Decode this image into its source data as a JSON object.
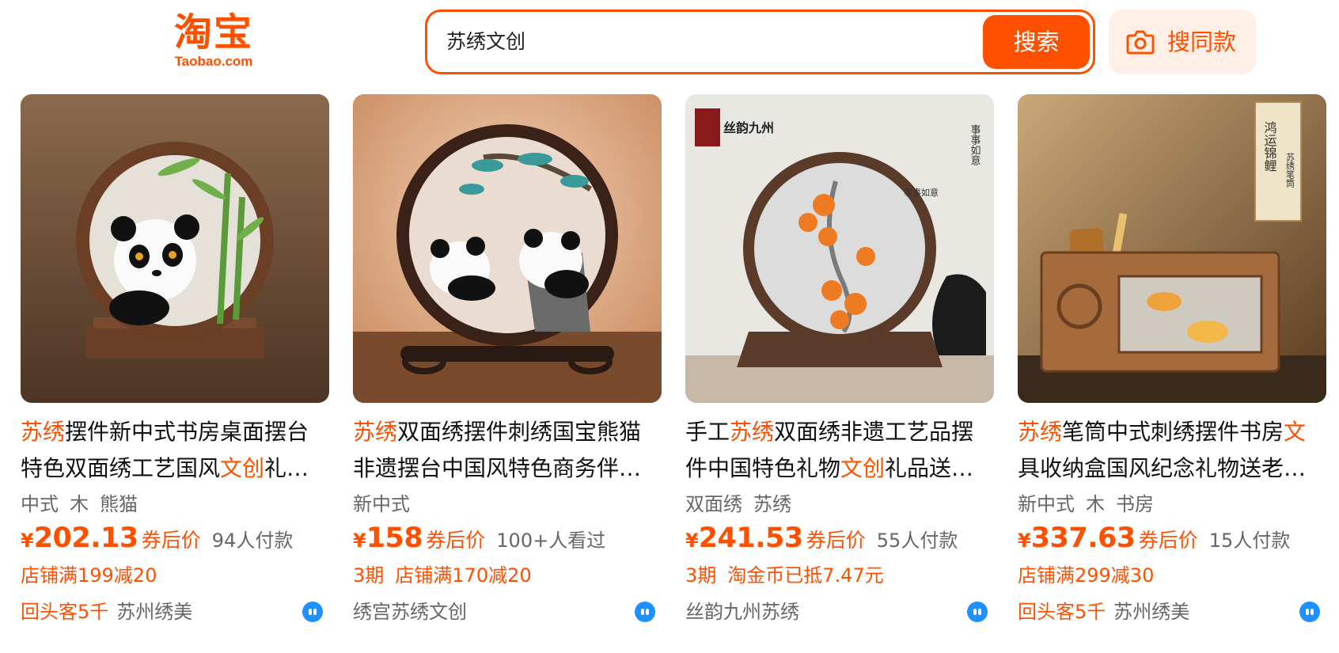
{
  "header": {
    "logo_mark": "淘宝",
    "logo_sub": "Taobao.com",
    "search_query": "苏绣文创",
    "search_button": "搜索",
    "same_button": "搜同款",
    "brand_color": "#ff5000"
  },
  "products": [
    {
      "title_parts": [
        [
          "苏绣",
          true
        ],
        [
          "摆件新中式书房桌面摆台特色双面绣工艺国风",
          false
        ],
        [
          "文创",
          true
        ],
        [
          "礼…",
          false
        ]
      ],
      "tags": [
        "中式",
        "木",
        "熊猫"
      ],
      "currency": "¥",
      "price": "202.13",
      "price_tag": "券后价",
      "sales": "94人付款",
      "promos": [
        "店铺满199减20"
      ],
      "repeat": "回头客5千",
      "shop": "苏州绣美"
    },
    {
      "title_parts": [
        [
          "苏绣",
          true
        ],
        [
          "双面绣摆件刺绣国宝熊猫非遗摆台中国风特色商务伴…",
          false
        ]
      ],
      "tags": [
        "新中式"
      ],
      "currency": "¥",
      "price": "158",
      "price_tag": "券后价",
      "sales": "100+人看过",
      "promos": [
        "3期",
        "店铺满170减20"
      ],
      "repeat": "",
      "shop": "绣宫苏绣文创"
    },
    {
      "title_parts": [
        [
          "手工",
          false
        ],
        [
          "苏绣",
          true
        ],
        [
          "双面绣非遗工艺品摆件中国特色礼物",
          false
        ],
        [
          "文创",
          true
        ],
        [
          "礼品送…",
          false
        ]
      ],
      "tags": [
        "双面绣",
        "苏绣"
      ],
      "currency": "¥",
      "price": "241.53",
      "price_tag": "券后价",
      "sales": "55人付款",
      "promos": [
        "3期",
        "淘金币已抵7.47元"
      ],
      "repeat": "",
      "shop": "丝韵九州苏绣"
    },
    {
      "title_parts": [
        [
          "苏绣",
          true
        ],
        [
          "笔筒中式刺绣摆件书房",
          false
        ],
        [
          "文",
          true
        ],
        [
          "具收纳盒国风纪念礼物送老…",
          false
        ]
      ],
      "tags": [
        "新中式",
        "木",
        "书房"
      ],
      "currency": "¥",
      "price": "337.63",
      "price_tag": "券后价",
      "sales": "15人付款",
      "promos": [
        "店铺满299减30"
      ],
      "repeat": "回头客5千",
      "shop": "苏州绣美"
    }
  ],
  "image_captions": {
    "p3_brand": "丝韵九州",
    "p3_poem": "事事如意",
    "p4_label": "鸿运锦鲤",
    "p4_sub": "苏绣笔筒"
  }
}
